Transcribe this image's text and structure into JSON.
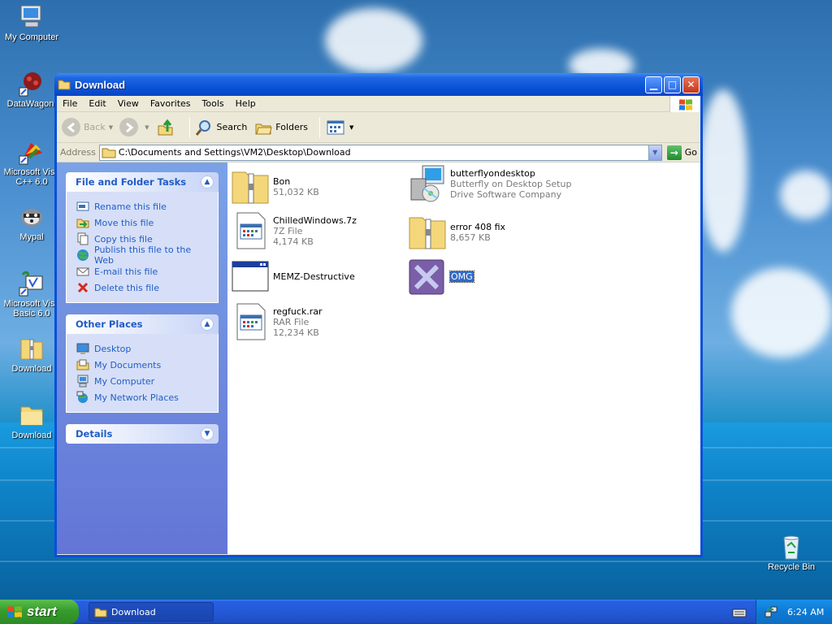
{
  "desktop": {
    "icons": [
      {
        "label": "My Computer",
        "icon": "my-computer-icon"
      },
      {
        "label": "DataWagon.",
        "icon": "datawagon-icon"
      },
      {
        "label": "Microsoft Visu C++ 6.0",
        "icon": "visual-cpp-icon"
      },
      {
        "label": "Mypal",
        "icon": "mypal-icon"
      },
      {
        "label": "Microsoft Visu Basic 6.0",
        "icon": "visual-basic-icon"
      },
      {
        "label": "Download",
        "icon": "zip-folder-icon"
      },
      {
        "label": "Download",
        "icon": "folder-icon"
      },
      {
        "label": "Recycle Bin",
        "icon": "recycle-bin-icon"
      }
    ]
  },
  "window": {
    "title": "Download",
    "menu": [
      "File",
      "Edit",
      "View",
      "Favorites",
      "Tools",
      "Help"
    ],
    "toolbar": {
      "back": "Back",
      "search": "Search",
      "folders": "Folders"
    },
    "address": {
      "label": "Address",
      "value": "C:\\Documents and Settings\\VM2\\Desktop\\Download",
      "go": "Go"
    },
    "taskpane": {
      "file_tasks": {
        "title": "File and Folder Tasks",
        "links": [
          {
            "label": "Rename this file",
            "icon": "rename-icon"
          },
          {
            "label": "Move this file",
            "icon": "move-icon"
          },
          {
            "label": "Copy this file",
            "icon": "copy-icon"
          },
          {
            "label": "Publish this file to the Web",
            "icon": "publish-web-icon"
          },
          {
            "label": "E-mail this file",
            "icon": "email-icon"
          },
          {
            "label": "Delete this file",
            "icon": "delete-icon"
          }
        ]
      },
      "other_places": {
        "title": "Other Places",
        "links": [
          {
            "label": "Desktop",
            "icon": "desktop-icon"
          },
          {
            "label": "My Documents",
            "icon": "my-documents-icon"
          },
          {
            "label": "My Computer",
            "icon": "my-computer-icon"
          },
          {
            "label": "My Network Places",
            "icon": "network-places-icon"
          }
        ]
      },
      "details": {
        "title": "Details"
      }
    },
    "files": [
      {
        "name": "Bon",
        "sub1": "51,032 KB",
        "sub2": "",
        "icon": "zip-folder-icon"
      },
      {
        "name": "butterflyondesktop",
        "sub1": "Butterfly on Desktop Setup",
        "sub2": "Drive Software Company",
        "icon": "installer-icon"
      },
      {
        "name": "ChilledWindows.7z",
        "sub1": "7Z File",
        "sub2": "4,174 KB",
        "icon": "archive-file-icon"
      },
      {
        "name": "error 408 fix",
        "sub1": "8,657 KB",
        "sub2": "",
        "icon": "zip-folder-icon"
      },
      {
        "name": "MEMZ-Destructive",
        "sub1": "",
        "sub2": "",
        "icon": "application-icon"
      },
      {
        "name": "OMG",
        "sub1": "",
        "sub2": "",
        "icon": "x-app-icon"
      },
      {
        "name": "regfuck.rar",
        "sub1": "RAR File",
        "sub2": "12,234 KB",
        "icon": "archive-file-icon"
      }
    ]
  },
  "taskbar": {
    "start": "start",
    "items": [
      {
        "label": "Download"
      }
    ],
    "clock": "6:24 AM"
  }
}
